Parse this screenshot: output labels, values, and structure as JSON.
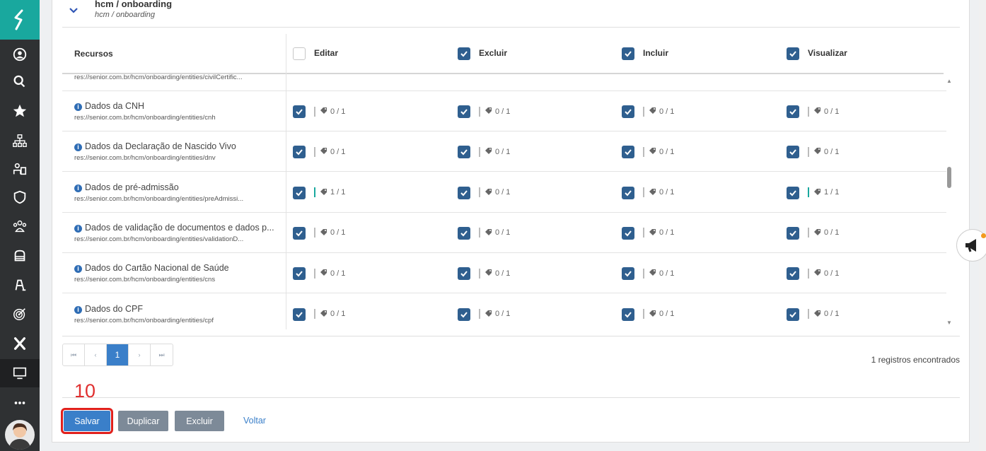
{
  "module": {
    "title": "hcm / onboarding",
    "subtitle": "hcm / onboarding"
  },
  "table": {
    "headers": {
      "resources": "Recursos",
      "edit": "Editar",
      "delete": "Excluir",
      "include": "Incluir",
      "view": "Visualizar"
    },
    "header_checked": {
      "edit": false,
      "delete": true,
      "include": true,
      "view": true
    },
    "partial_row_path": "res://senior.com.br/hcm/onboarding/entities/civilCertific...",
    "rows": [
      {
        "name": "Dados da CNH",
        "path": "res://senior.com.br/hcm/onboarding/entities/cnh",
        "edit": "0 / 1",
        "delete": "0 / 1",
        "include": "0 / 1",
        "view": "0 / 1"
      },
      {
        "name": "Dados da Declaração de Nascido Vivo",
        "path": "res://senior.com.br/hcm/onboarding/entities/dnv",
        "edit": "0 / 1",
        "delete": "0 / 1",
        "include": "0 / 1",
        "view": "0 / 1"
      },
      {
        "name": "Dados de pré-admissão",
        "path": "res://senior.com.br/hcm/onboarding/entities/preAdmissi...",
        "edit": "1 / 1",
        "delete": "0 / 1",
        "include": "0 / 1",
        "view": "1 / 1"
      },
      {
        "name": "Dados de validação de documentos e dados p...",
        "path": "res://senior.com.br/hcm/onboarding/entities/validationD...",
        "edit": "0 / 1",
        "delete": "0 / 1",
        "include": "0 / 1",
        "view": "0 / 1"
      },
      {
        "name": "Dados do Cartão Nacional de Saúde",
        "path": "res://senior.com.br/hcm/onboarding/entities/cns",
        "edit": "0 / 1",
        "delete": "0 / 1",
        "include": "0 / 1",
        "view": "0 / 1"
      },
      {
        "name": "Dados do CPF",
        "path": "res://senior.com.br/hcm/onboarding/entities/cpf",
        "edit": "0 / 1",
        "delete": "0 / 1",
        "include": "0 / 1",
        "view": "0 / 1"
      }
    ]
  },
  "pagination": {
    "first": "⏮",
    "prev": "‹",
    "current": "1",
    "next": "›",
    "last": "⏭",
    "records": "1 registros encontrados"
  },
  "step_number": "10",
  "actions": {
    "save": "Salvar",
    "duplicate": "Duplicar",
    "delete": "Excluir",
    "back": "Voltar"
  },
  "colors": {
    "accent": "#3a7fc9",
    "brand": "#19a89e",
    "checkbox": "#2f5f8f",
    "highlight": "#e0201c"
  },
  "icons": [
    "senior-logo-icon",
    "user-circle-icon",
    "search-icon",
    "star-icon",
    "org-chart-icon",
    "people-icon",
    "shield-icon",
    "team-icon",
    "database-icon",
    "accessibility-icon",
    "target-icon",
    "x-icon",
    "monitor-icon",
    "more-icon",
    "megaphone-icon"
  ]
}
